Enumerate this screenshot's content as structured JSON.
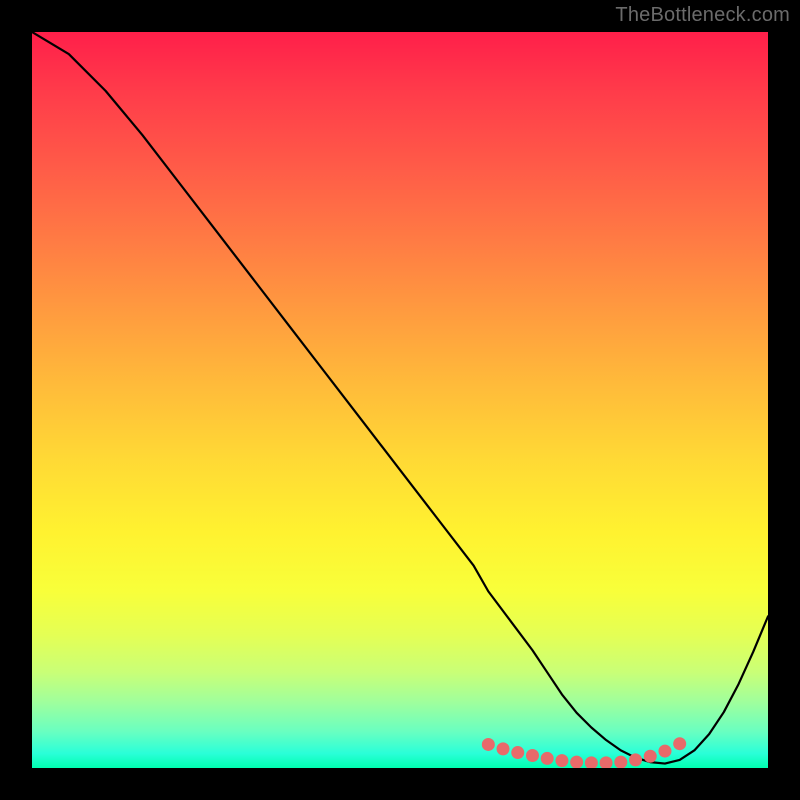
{
  "watermark": "TheBottleneck.com",
  "chart_data": {
    "type": "line",
    "title": "",
    "xlabel": "",
    "ylabel": "",
    "xlim": [
      0,
      100
    ],
    "ylim": [
      0,
      100
    ],
    "series": [
      {
        "name": "curve",
        "x": [
          0,
          5,
          10,
          15,
          20,
          25,
          30,
          35,
          40,
          45,
          50,
          55,
          60,
          62,
          65,
          68,
          70,
          72,
          74,
          76,
          78,
          80,
          82,
          84,
          86,
          88,
          90,
          92,
          94,
          96,
          98,
          100
        ],
        "y": [
          100,
          97,
          92,
          86,
          79.5,
          73,
          66.5,
          60,
          53.5,
          47,
          40.5,
          34,
          27.5,
          24,
          20,
          16,
          13,
          10,
          7.5,
          5.5,
          3.8,
          2.4,
          1.4,
          0.8,
          0.6,
          1.1,
          2.4,
          4.6,
          7.6,
          11.4,
          15.8,
          20.6
        ]
      },
      {
        "name": "highlight-dots",
        "x": [
          62,
          64,
          66,
          68,
          70,
          72,
          74,
          76,
          78,
          80,
          82,
          84,
          86,
          88
        ],
        "y": [
          3.2,
          2.6,
          2.1,
          1.7,
          1.3,
          1.0,
          0.8,
          0.7,
          0.7,
          0.8,
          1.1,
          1.6,
          2.3,
          3.3
        ]
      }
    ],
    "colors": {
      "curve": "#000000",
      "dots": "#e86a6a"
    }
  }
}
